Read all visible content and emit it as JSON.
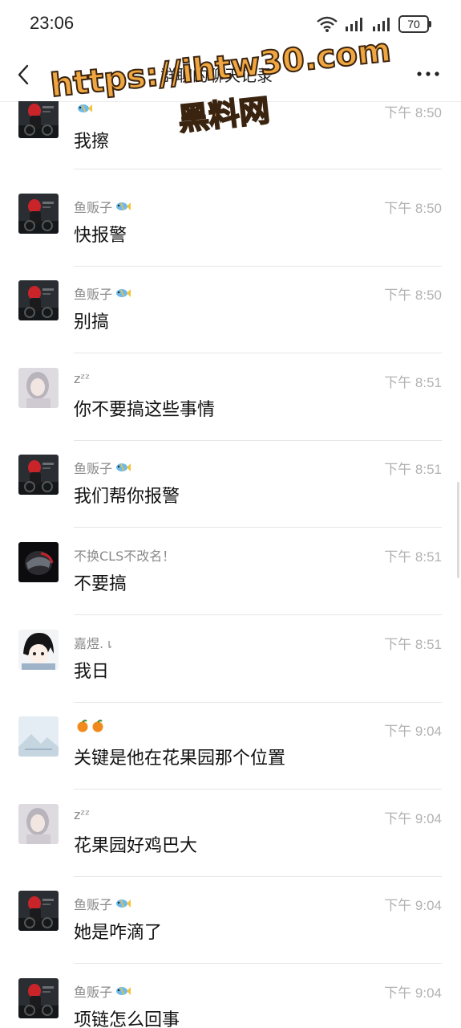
{
  "status_bar": {
    "time": "23:06",
    "battery": "70"
  },
  "header": {
    "title": "群聊的聊天记录",
    "back_icon": "chevron-left-icon",
    "more_icon": "more-dots-icon"
  },
  "watermark": {
    "line1": "https://ihtw30.com",
    "line2": "黑料网"
  },
  "messages": [
    {
      "sender": "",
      "emoji": "fish",
      "time": "下午 8:50",
      "text": "我擦",
      "avatar": "moto"
    },
    {
      "sender": "鱼贩子",
      "emoji": "fish",
      "time": "下午 8:50",
      "text": "快报警",
      "avatar": "moto"
    },
    {
      "sender": "鱼贩子",
      "emoji": "fish",
      "time": "下午 8:50",
      "text": "别搞",
      "avatar": "moto"
    },
    {
      "sender": "zᶻᶻ",
      "emoji": "",
      "time": "下午 8:51",
      "text": "你不要搞这些事情",
      "avatar": "girl"
    },
    {
      "sender": "鱼贩子",
      "emoji": "fish",
      "time": "下午 8:51",
      "text": "我们帮你报警",
      "avatar": "moto"
    },
    {
      "sender": "不换CLS不改名！",
      "emoji": "",
      "time": "下午 8:51",
      "text": "不要搞",
      "avatar": "helmet"
    },
    {
      "sender": "嘉煜. เ",
      "emoji": "",
      "time": "下午 8:51",
      "text": "我日",
      "avatar": "anime"
    },
    {
      "sender": "",
      "emoji": "oranges",
      "time": "下午 9:04",
      "text": "关键是他在花果园那个位置",
      "avatar": "landscape"
    },
    {
      "sender": "zᶻᶻ",
      "emoji": "",
      "time": "下午 9:04",
      "text": "花果园好鸡巴大",
      "avatar": "girl"
    },
    {
      "sender": "鱼贩子",
      "emoji": "fish",
      "time": "下午 9:04",
      "text": "她是咋滴了",
      "avatar": "moto"
    },
    {
      "sender": "鱼贩子",
      "emoji": "fish",
      "time": "下午 9:04",
      "text": "项链怎么回事",
      "avatar": "moto"
    }
  ]
}
